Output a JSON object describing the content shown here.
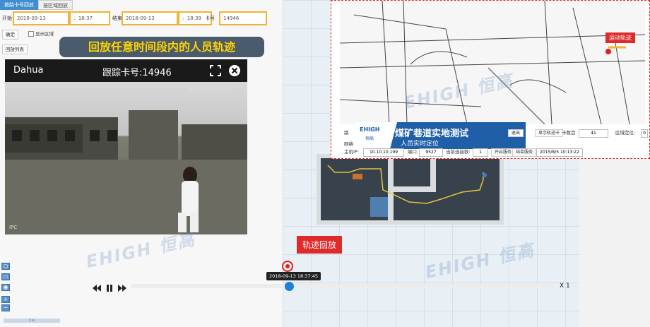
{
  "tabs": [
    {
      "label": "按路卡号回放"
    },
    {
      "label": "按区域回放"
    }
  ],
  "form": {
    "start_label": "开始",
    "start_date": "2018-09-13",
    "start_sep": ":",
    "start_time": "18:37",
    "end_label": "结束",
    "end_date": "2018-09-13",
    "end_sep": ":",
    "end_time": "18:39",
    "card_label": "卡号",
    "card_value": "14946",
    "confirm_label": "确定",
    "show_area_label": "显示区域",
    "playback_list_label": "回放列表"
  },
  "banner": {
    "text": "回放任意时间段内的人员轨迹"
  },
  "video": {
    "brand": "Dahua",
    "title": "跟踪卡号:14946",
    "timestamp": "2018-09-13 18:37:45",
    "corner": "IPC"
  },
  "map": {
    "tag": "运动轨迹",
    "mine_title": "煤矿巷道实地测试",
    "mine_subtitle": "人员实时定位",
    "logo_text": "EHIGH",
    "logo_sub": "恒高",
    "row1": {
      "label_a": "路",
      "btn_a": "退出",
      "btn_b": "显示轨迹卡",
      "label_count": "卡数目",
      "count": "41",
      "label_area": "区域定位:",
      "area_value": "0"
    },
    "row2": {
      "label_main": "主机IP:",
      "ip": "10.10.10.199",
      "label_port": "端口:",
      "port": "9527",
      "label_conn": "当前连接数:",
      "conn": "1",
      "btn_start": "开启服务",
      "btn_stop": "结束服务",
      "datetime": "2015/8/5 10:13:22"
    },
    "row3": {
      "label": "网络"
    }
  },
  "replay_tag": "轨迹回放",
  "player": {
    "tooltip": "2018-09-13 18:37:45",
    "speed": "X 1"
  },
  "watermark": {
    "text": "EHIGH 恒高"
  },
  "bottom_scale": {
    "label": "5 m"
  }
}
